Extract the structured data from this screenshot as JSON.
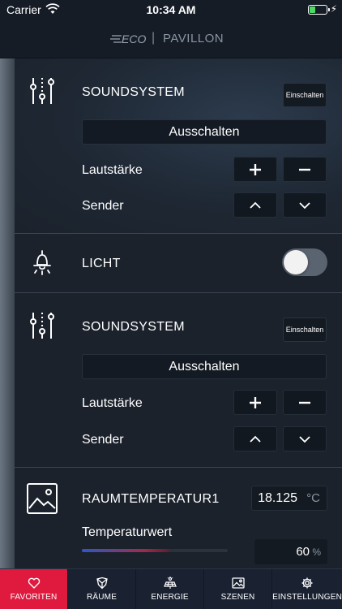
{
  "status_bar": {
    "carrier": "Carrier",
    "time": "10:34 AM",
    "battery_level": 0.35
  },
  "header": {
    "logo_text": "ECO",
    "separator": "|",
    "title": "PAVILLON"
  },
  "devices": {
    "sound1": {
      "title": "SOUNDSYSTEM",
      "on_label": "Einschalten",
      "off_label": "Ausschalten",
      "volume_label": "Lautstärke",
      "station_label": "Sender",
      "plus": "+",
      "minus": "−"
    },
    "light": {
      "title": "LICHT",
      "toggle_on": false
    },
    "sound2": {
      "title": "SOUNDSYSTEM",
      "on_label": "Einschalten",
      "off_label": "Ausschalten",
      "volume_label": "Lautstärke",
      "station_label": "Sender",
      "plus": "+",
      "minus": "−"
    },
    "temp": {
      "title": "RAUMTEMPERATUR1",
      "value": "18.125",
      "unit": "°C",
      "slider_label": "Temperaturwert",
      "percent_value": "60",
      "percent_unit": "%",
      "slider_fraction": 0.6
    }
  },
  "tabbar": {
    "tabs": [
      {
        "label": "FAVORITEN",
        "icon": "heart-icon",
        "active": true
      },
      {
        "label": "RÄUME",
        "icon": "shield-icon",
        "active": false
      },
      {
        "label": "ENERGIE",
        "icon": "solar-panel-icon",
        "active": false
      },
      {
        "label": "SZENEN",
        "icon": "image-icon",
        "active": false
      },
      {
        "label": "EINSTELLUNGEN",
        "icon": "gear-icon",
        "active": false
      }
    ]
  },
  "colors": {
    "accent": "#e0193f",
    "background": "#1b222c",
    "header": "#151c26",
    "tabbar": "#1a2232"
  }
}
